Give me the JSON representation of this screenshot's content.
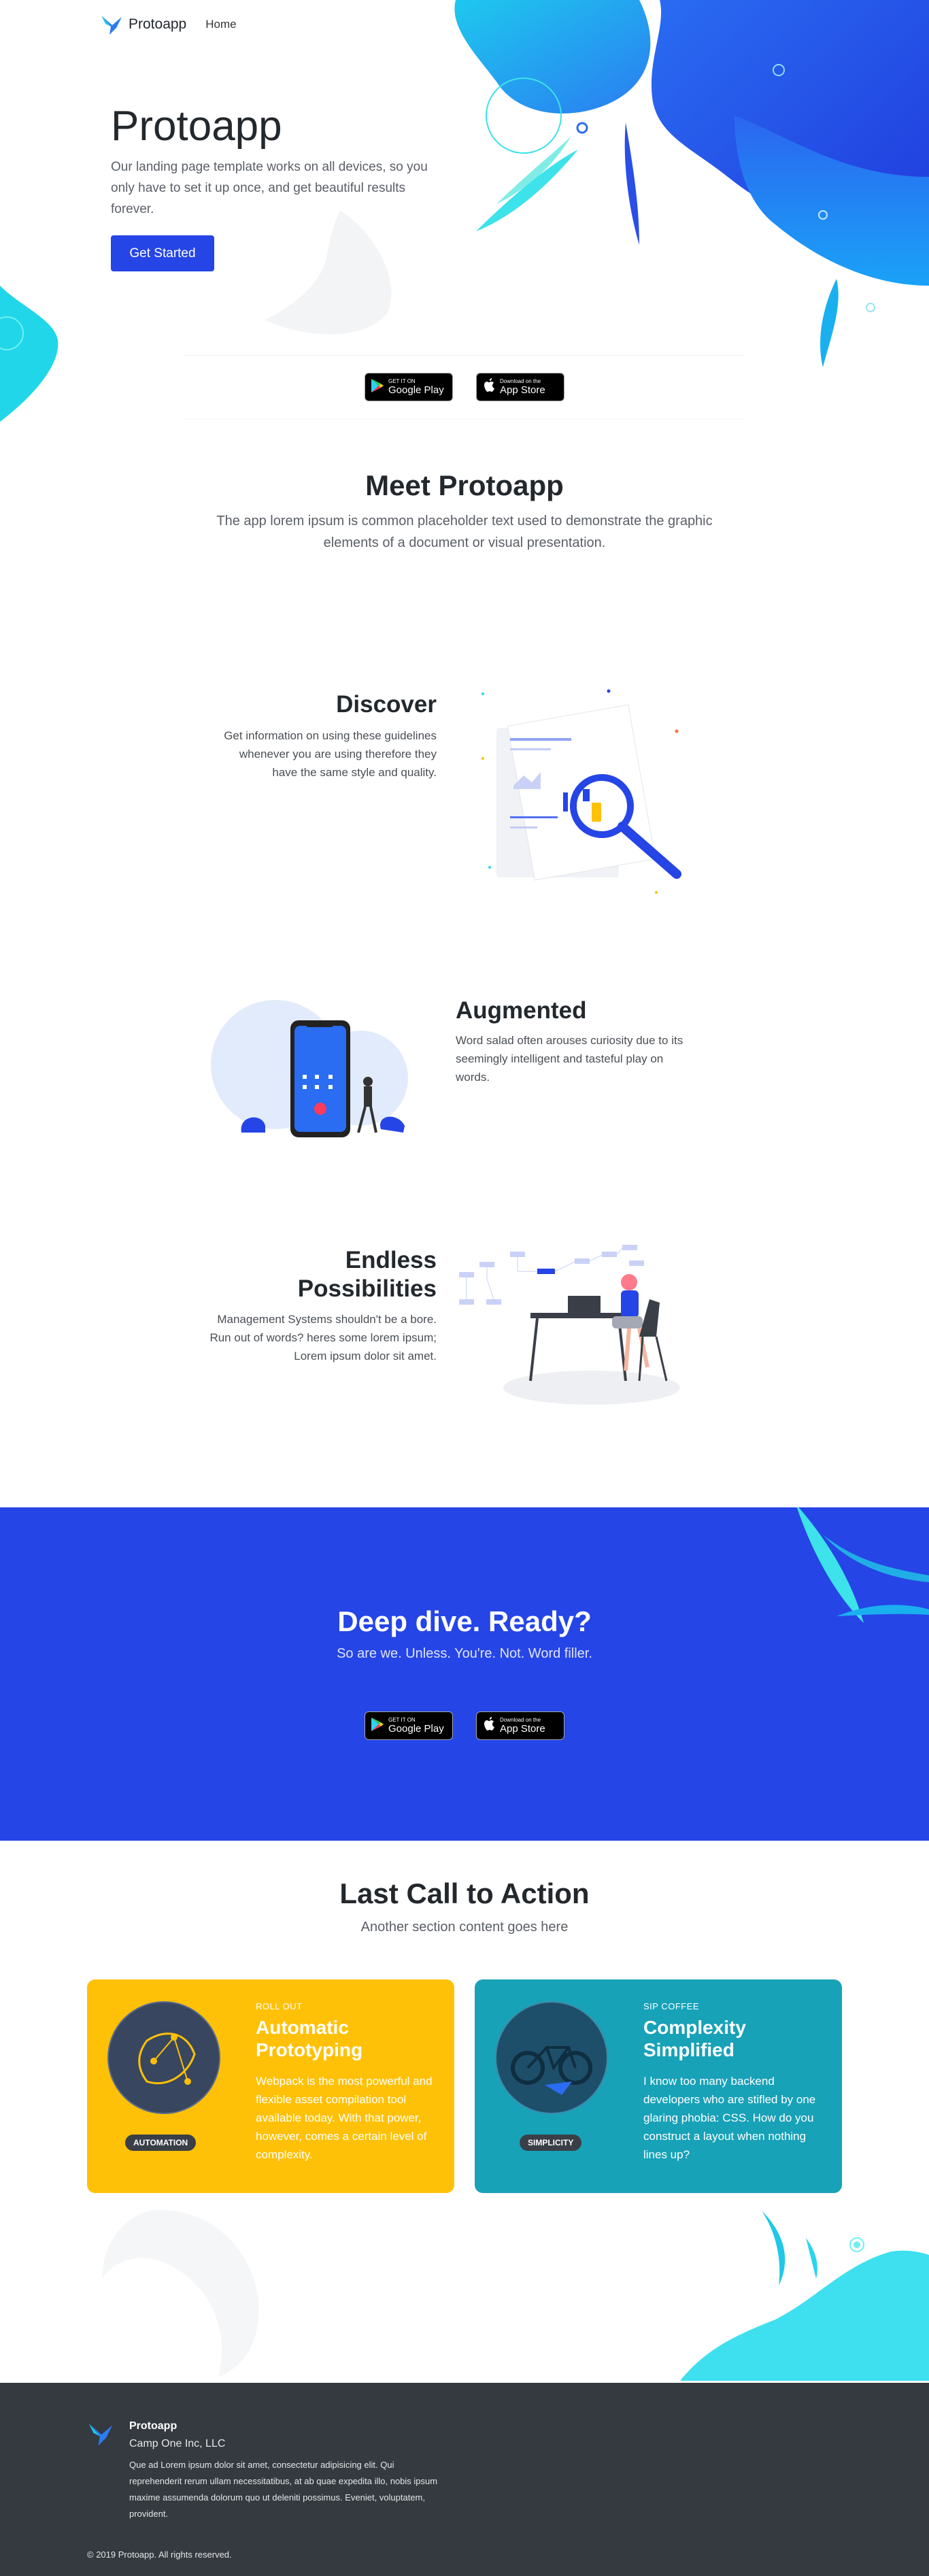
{
  "nav": {
    "brand": "Protoapp",
    "home_link": "Home"
  },
  "hero": {
    "title": "Protoapp",
    "text": "Our landing page template works on all devices, so you only have to set it up once, and get beautiful results forever.",
    "cta_label": "Get Started"
  },
  "badges": {
    "google_small": "GET IT ON",
    "google_big": "Google Play",
    "apple_small": "Download on the",
    "apple_big": "App Store"
  },
  "meet": {
    "title": "Meet Protoapp",
    "subtitle": "The app lorem ipsum is common placeholder text used to demonstrate the graphic elements of a document or visual presentation."
  },
  "features": [
    {
      "title": "Discover",
      "text": "Get information on using these guidelines whenever you are using therefore they have the same style and quality."
    },
    {
      "title": "Augmented",
      "text": "Word salad often arouses curiosity due to its seemingly intelligent and tasteful play on words."
    },
    {
      "title": "Endless Possibilities",
      "text": "Management Systems shouldn't be a bore. Run out of words? heres some lorem ipsum; Lorem ipsum dolor sit amet."
    }
  ],
  "cta_band": {
    "title": "Deep dive. Ready?",
    "subtitle": "So are we. Unless. You're. Not. Word filler."
  },
  "last_call": {
    "title": "Last Call to Action",
    "subtitle": "Another section content goes here"
  },
  "cards": [
    {
      "eyebrow": "ROLL OUT",
      "title": "Automatic Prototyping",
      "text": "Webpack is the most powerful and flexible asset compilation tool available today. With that power, however, comes a certain level of complexity.",
      "pill": "AUTOMATION",
      "color": "#ffc107"
    },
    {
      "eyebrow": "SIP COFFEE",
      "title": "Complexity Simplified",
      "text": "I know too many backend developers who are stifled by one glaring phobia: CSS. How do you construct a layout when nothing lines up?",
      "pill": "SIMPLICITY",
      "color": "#17a2b8"
    }
  ],
  "footer": {
    "brand": "Protoapp",
    "company": "Camp One Inc, LLC",
    "text": "Que ad Lorem ipsum dolor sit amet, consectetur adipisicing elit. Qui reprehenderit rerum ullam necessitatibus, at ab quae expedita illo, nobis ipsum maxime assumenda dolorum quo ut deleniti possimus. Eveniet, voluptatem, provident.",
    "copyright": "© 2019 Protoapp. All rights reserved."
  },
  "colors": {
    "primary": "#2545e6",
    "dark": "#343a40",
    "yellow": "#ffc107",
    "teal": "#17a2b8",
    "cyan": "#3ee0ef"
  }
}
